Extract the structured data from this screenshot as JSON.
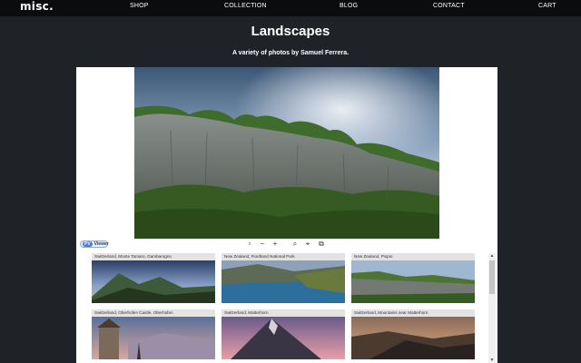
{
  "nav": {
    "logo": "misc.",
    "links": [
      "SHOP",
      "COLLECTION",
      "BLOG",
      "CONTACT",
      "CART"
    ]
  },
  "page": {
    "title": "Landscapes",
    "subtitle": "A variety of photos by Samuel Ferrera."
  },
  "viewer": {
    "badge_pre": "PV",
    "badge_text": "Viewer",
    "toolbar": {
      "icons": [
        "fit-screen-icon",
        "zoom-out-icon",
        "zoom-in-icon",
        "magnifier-icon",
        "crosshair-icon",
        "fullscreen-icon"
      ],
      "glyphs": [
        "▫",
        "−",
        "+",
        "⌕",
        "⌖",
        "⧉"
      ]
    },
    "thumbnails": [
      {
        "label": "Switzerland, Monte Tamaro, Gambarogno"
      },
      {
        "label": "New Zealand, Fiordland National Park"
      },
      {
        "label": "New Zealand, Piopio"
      },
      {
        "label": "Switzerland, Oberhofen Castle, Oberhofen"
      },
      {
        "label": "Switzerland, Matterhorn"
      },
      {
        "label": "Switzerland, Mountains near Matterhorn"
      }
    ],
    "scroll_up": "▲",
    "scroll_down": "▼"
  },
  "colors": {
    "background": "#1f2327",
    "nav_bar": "#0b0c0d",
    "viewer_bg": "#ffffff",
    "label_bg": "#e3e3e3"
  }
}
